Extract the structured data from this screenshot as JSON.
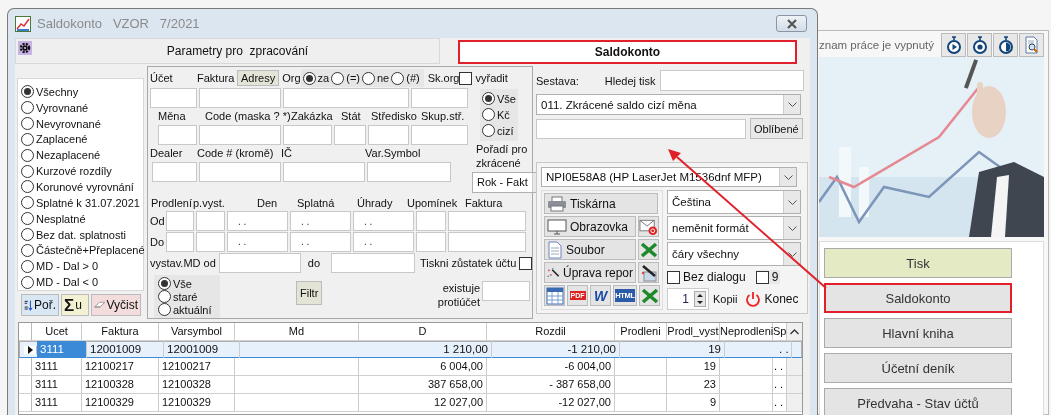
{
  "window": {
    "title": "Saldokonto   VZOR   7/2021"
  },
  "params_header": "Parametry pro  zpracování",
  "report_title": {
    "text": "Saldokonto",
    "outlined": true
  },
  "filter_options": [
    {
      "label": "Všechny",
      "selected": true
    },
    {
      "label": "Vyrovnané",
      "selected": false
    },
    {
      "label": "Nevyrovnané",
      "selected": false
    },
    {
      "label": "Zaplacené",
      "selected": false
    },
    {
      "label": "Nezaplacené",
      "selected": false
    },
    {
      "label": "Kurzové rozdíly",
      "selected": false
    },
    {
      "label": "Korunové vyrovnání",
      "selected": false
    },
    {
      "label": "Splatné k 31.07.2021",
      "selected": false
    },
    {
      "label": "Nesplatné",
      "selected": false
    },
    {
      "label": "Bez dat. splatnosti",
      "selected": false
    },
    {
      "label": "Částečně+Přeplacené",
      "selected": false
    },
    {
      "label": "MD - Dal > 0",
      "selected": false
    },
    {
      "label": "MD - Dal < 0",
      "selected": false
    }
  ],
  "list_buttons": [
    {
      "kind": "sort",
      "label": "Poř."
    },
    {
      "kind": "sum",
      "symbol": "Σ",
      "label": "u"
    },
    {
      "kind": "clear",
      "label": "Vyčist"
    }
  ],
  "form": {
    "account_label": "Účet",
    "invoice_label": "Faktura",
    "addresses_button": "Adresy",
    "org_label": "Org",
    "org_options": [
      {
        "label": "za",
        "selected": true
      },
      {
        "label": "(=)",
        "selected": false
      },
      {
        "label": "ne",
        "selected": false
      },
      {
        "label": "(#)",
        "selected": false
      }
    ],
    "skorg_label": "Sk.org",
    "exclude": {
      "label": "vyřadit",
      "checked": false
    },
    "currency_options": [
      {
        "label": "Vše",
        "selected": true
      },
      {
        "label": "Kč",
        "selected": false
      },
      {
        "label": "cizí",
        "selected": false
      }
    ],
    "row3_labels": [
      "Měna",
      "Code (maska ? *)",
      "Zakázka",
      "Stát",
      "Středisko",
      "Skup.stř."
    ],
    "row5_labels": [
      "Dealer",
      "Code # (kromě)",
      "IČ",
      "Var.Symbol"
    ],
    "order_label": "Pořadí pro zkrácené",
    "order_select": "Rok - Fakt",
    "range_labels": [
      "Prodlení",
      "p.vyst.",
      "Den",
      "Splatná",
      "Úhrady",
      "Upomínek",
      "Faktura"
    ],
    "range_rows": [
      {
        "label": "Od",
        "values": {
          "den": ". .",
          "splatna": ". .",
          "uhrady": ". ."
        }
      },
      {
        "label": "Do",
        "values": {
          "den": ". .",
          "splatna": ". .",
          "uhrady": ". ."
        }
      }
    ],
    "issued_from_label": "vystav.MD od",
    "issued_to_label": "do",
    "print_balance": {
      "label": "Tiskni zůstatek účtu",
      "checked": false
    },
    "age_options": [
      {
        "label": "Vše",
        "selected": true
      },
      {
        "label": "staré",
        "selected": false
      },
      {
        "label": "aktuální",
        "selected": false
      }
    ],
    "filter_button": "Filtr",
    "counter_label": "existuje protiúčet"
  },
  "print": {
    "report_label": "Sestava:",
    "search_label": "Hledej tisk",
    "report_select": "011. Zkrácené saldo cizí měna",
    "favorites_button": "Oblíbené",
    "printer_select": "NPI0E58A8 (HP LaserJet M1536dnf MFP)",
    "outputs": [
      {
        "kind": "printer",
        "label": "Tiskárna"
      },
      {
        "kind": "screen",
        "label": "Obrazovka",
        "extra": {
          "kind": "mail"
        }
      },
      {
        "kind": "file",
        "label": "Soubor",
        "extra": {
          "kind": "excel"
        }
      },
      {
        "kind": "edit",
        "label": "Úprava repor",
        "extra": {
          "kind": "wand"
        }
      }
    ],
    "format_icons": [
      {
        "kind": "grid"
      },
      {
        "kind": "pdf",
        "text": "PDF"
      },
      {
        "kind": "word",
        "text": "W"
      },
      {
        "kind": "html",
        "text": "HTML"
      },
      {
        "kind": "excel"
      }
    ],
    "selects": [
      "Čeština",
      "neměnit formát",
      "čáry všechny"
    ],
    "no_dialog": {
      "label": "Bez dialogu",
      "checked": false
    },
    "nine": {
      "label": "9",
      "checked": false
    },
    "copies": "1",
    "copies_label": "Kopii",
    "exit_button": "Konec"
  },
  "table": {
    "columns": [
      {
        "label": "Ucet"
      },
      {
        "label": "Faktura"
      },
      {
        "label": "Varsymbol"
      },
      {
        "label": "Md"
      },
      {
        "label": "D"
      },
      {
        "label": "Rozdil"
      },
      {
        "label": "Prodleni"
      },
      {
        "label": "Prodl_vyst"
      },
      {
        "label": "Neprodleni"
      },
      {
        "label": "Sp"
      }
    ],
    "rows": [
      {
        "selected": true,
        "cells": [
          {
            "text": "3111"
          },
          {
            "text": "12001009"
          },
          {
            "text": "12001009"
          },
          {},
          {
            "text": "1 210,00"
          },
          {
            "text": "-1 210,00"
          },
          {},
          {
            "text": "19"
          },
          {},
          {
            "text": ". ."
          }
        ]
      },
      {
        "selected": false,
        "cells": [
          {
            "text": "3111"
          },
          {
            "text": "12100217"
          },
          {
            "text": "12100217"
          },
          {},
          {
            "text": "6 004,00"
          },
          {
            "text": "-6 004,00"
          },
          {},
          {
            "text": "19"
          },
          {},
          {
            "text": ". ."
          }
        ]
      },
      {
        "selected": false,
        "cells": [
          {
            "text": "3111"
          },
          {
            "text": "12100328"
          },
          {
            "text": "12100328"
          },
          {},
          {
            "text": "387 658,00"
          },
          {
            "text": "- 387 658,00"
          },
          {},
          {
            "text": "23"
          },
          {},
          {
            "text": ". ."
          }
        ]
      },
      {
        "selected": false,
        "cells": [
          {
            "text": "3111"
          },
          {
            "text": "12100329"
          },
          {
            "text": "12100329"
          },
          {},
          {
            "text": "12 027,00"
          },
          {
            "text": "-12 027,00"
          },
          {},
          {
            "text": "9"
          },
          {},
          {
            "text": ". ."
          }
        ]
      }
    ]
  },
  "side_panel": {
    "status_text": "znam práce je vypnutý",
    "toolbar_icons": [
      {
        "kind": "play"
      },
      {
        "kind": "stop"
      },
      {
        "kind": "half"
      },
      {
        "kind": "preview"
      }
    ],
    "nav_buttons": [
      {
        "label": "Tisk",
        "selected": true,
        "outlined": false
      },
      {
        "label": "Saldokonto",
        "selected": false,
        "outlined": true
      },
      {
        "label": "Hlavní kniha",
        "selected": false,
        "outlined": false
      },
      {
        "label": "Účetní deník",
        "selected": false,
        "outlined": false
      },
      {
        "label": "Předvaha - Stav účtů",
        "selected": false,
        "outlined": false
      }
    ]
  }
}
